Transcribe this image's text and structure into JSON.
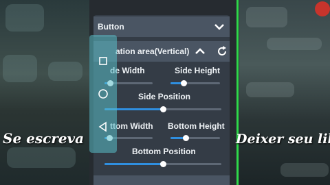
{
  "sections": {
    "button_label": "Button",
    "location_label": "ation area(Vertical)"
  },
  "side": {
    "width_label": "de Width",
    "height_label": "Side Height",
    "position_label": "Side Position",
    "width_value": 0.12,
    "height_value": 0.26,
    "position_value": 0.5
  },
  "bottom": {
    "width_label": "ttom Width",
    "height_label": "Bottom Height",
    "position_label": "Bottom Position",
    "width_value": 0.1,
    "height_value": 0.3,
    "position_value": 0.5
  },
  "overlay": {
    "left_caption": "Se escreva",
    "right_caption": "Deixer seu like"
  },
  "nav_icons": [
    "square-icon",
    "circle-icon",
    "back-triangle-icon"
  ],
  "colors": {
    "accent": "#2f8fe0",
    "nav_bar": "#5abec8",
    "divider_green": "#2fd94a"
  }
}
